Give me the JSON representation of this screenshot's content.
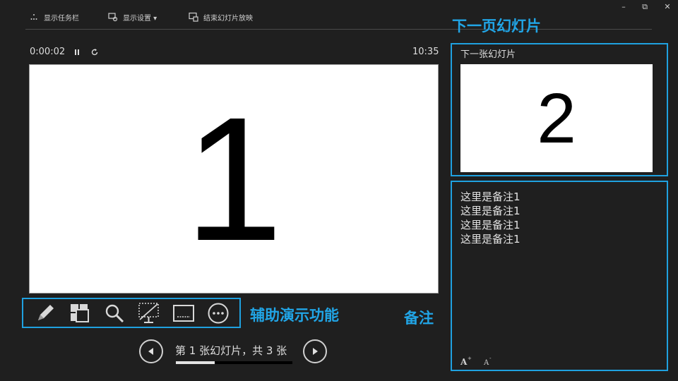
{
  "window_controls": {
    "minimize": "–",
    "restore": "⧉",
    "close": "✕"
  },
  "toolbar": {
    "items": [
      {
        "label": "显示任务栏",
        "icon": "taskbar-icon"
      },
      {
        "label": "显示设置 ▾",
        "icon": "display-settings-icon"
      },
      {
        "label": "结束幻灯片放映",
        "icon": "end-slideshow-icon"
      }
    ]
  },
  "presenter": {
    "timer": "0:00:02",
    "pause_icon": "pause-icon",
    "reset_icon": "reset-icon",
    "clock": "10:35",
    "current_slide_number": "1"
  },
  "tools": [
    {
      "name": "pen",
      "icon": "pen-icon"
    },
    {
      "name": "see-all-slides",
      "icon": "see-all-slides-icon"
    },
    {
      "name": "zoom",
      "icon": "magnifier-icon"
    },
    {
      "name": "black-screen",
      "icon": "black-screen-icon"
    },
    {
      "name": "subtitles",
      "icon": "subtitles-icon"
    },
    {
      "name": "more-options",
      "icon": "more-options-icon"
    }
  ],
  "annotations": {
    "tools": "辅助演示功能",
    "notes": "备注",
    "next_slide": "下一页幻灯片"
  },
  "navigation": {
    "text": "第 1 张幻灯片，共 3 张",
    "current": 1,
    "total": 3
  },
  "next_slide": {
    "label": "下一张幻灯片",
    "number": "2"
  },
  "notes": {
    "lines": [
      "这里是备注1",
      "这里是备注1",
      "这里是备注1",
      "这里是备注1"
    ]
  },
  "colors": {
    "background": "#1f1f1f",
    "accent": "#1fa1e0",
    "annotation": "#21a5e6",
    "text": "#dedede"
  }
}
